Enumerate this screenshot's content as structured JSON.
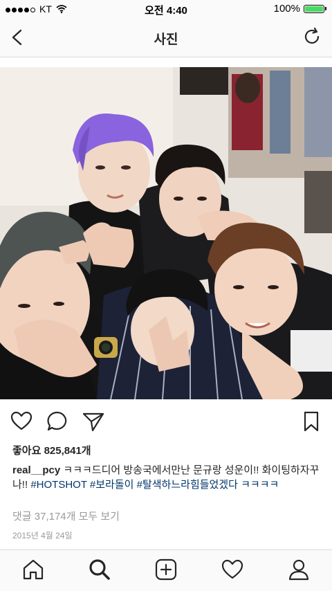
{
  "status_bar": {
    "carrier": "KT",
    "time": "오전 4:40",
    "battery": "100%",
    "battery_level": 1.0,
    "signal_bars": 4,
    "signal_total": 5
  },
  "nav": {
    "title": "사진",
    "back_icon": "chevron-left-icon",
    "refresh_icon": "refresh-icon"
  },
  "post": {
    "likes_label": "좋아요 825,841개",
    "username": "real__pcy",
    "caption_text": " ㅋㅋㅋ드디어 방송국에서만난 문규랑 성운이!! 화이팅하자꾸나!! ",
    "hashtags": [
      "#HOTSHOT",
      "#보라돌이",
      "#탈색하느라힘들었겠다"
    ],
    "caption_tail": "ㅋㅋㅋㅋ",
    "comments_label": "댓글 37,174개 모두 보기",
    "date": "2015년 4월 24일"
  },
  "actions": {
    "like_icon": "heart-icon",
    "comment_icon": "comment-icon",
    "share_icon": "send-icon",
    "save_icon": "bookmark-icon"
  },
  "tabbar": {
    "items": [
      "home-icon",
      "search-icon",
      "add-post-icon",
      "activity-heart-icon",
      "profile-icon"
    ]
  },
  "colors": {
    "hashtag": "#003569",
    "muted": "#999999",
    "battery": "#4cd964",
    "bar_bg": "#fafafa"
  }
}
